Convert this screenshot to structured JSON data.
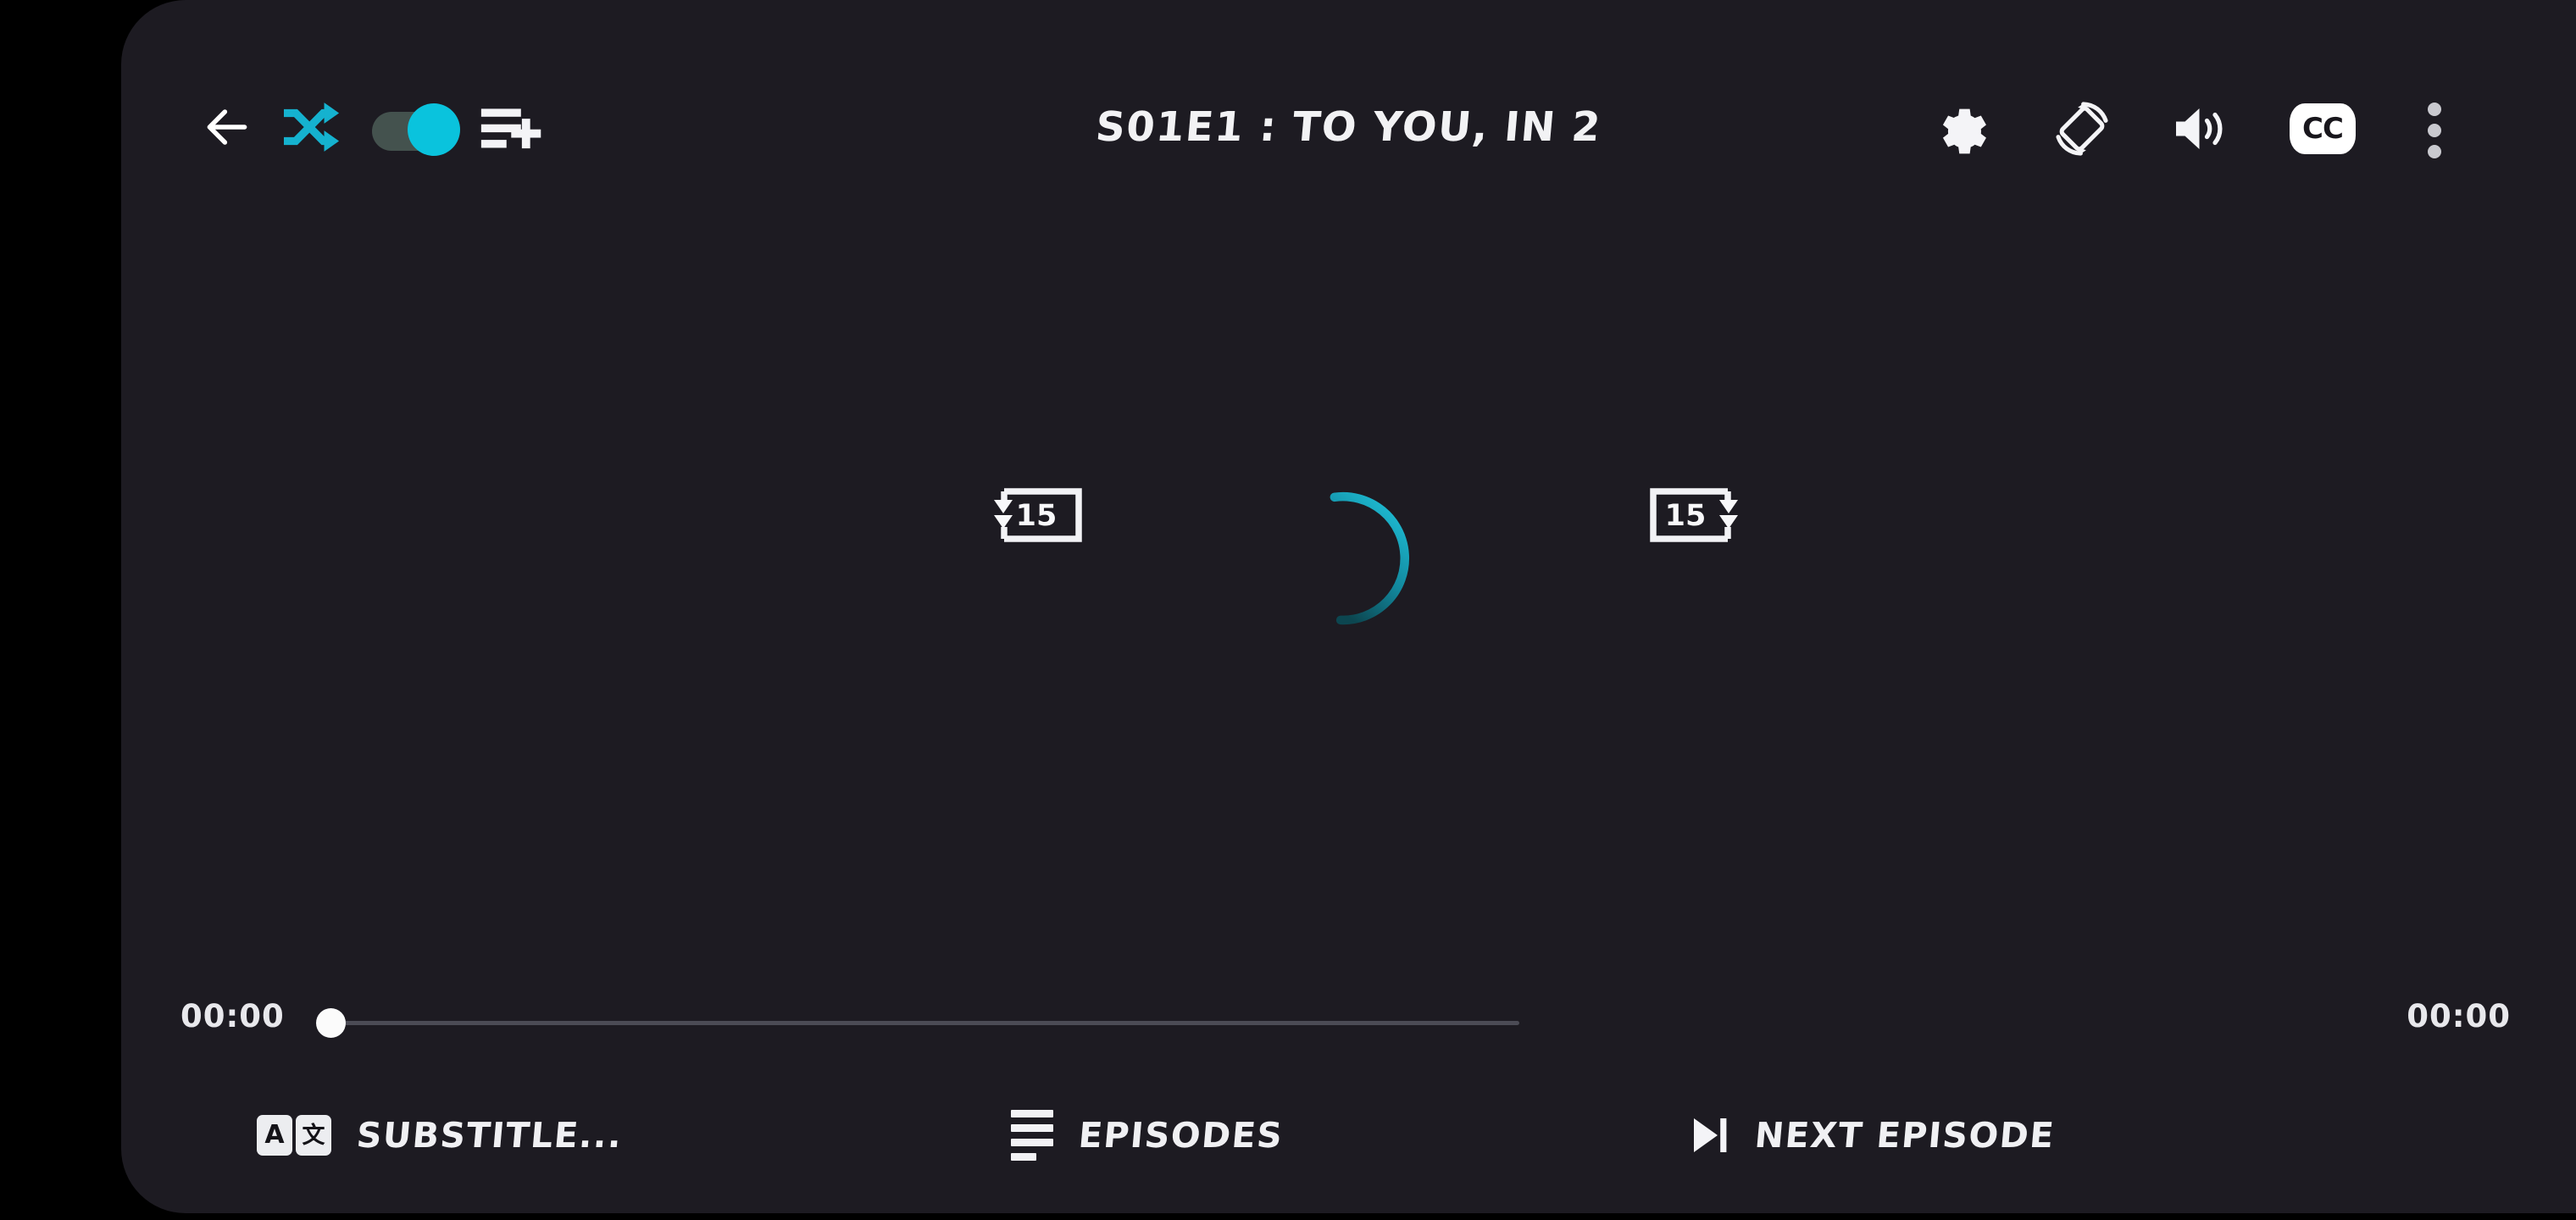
{
  "app": {
    "kind": "video-player-overlay",
    "accent_color": "#0ac3dd",
    "panel_bg": "#1d1b22",
    "outer_bg": "#000000"
  },
  "topbar": {
    "back_label": "back",
    "shuffle_label": "shuffle",
    "autoplay_toggle": {
      "state": "on",
      "label": "autoplay"
    },
    "playlist_add_label": "add to playlist",
    "title": "S01E1 : TO YOU, IN 2",
    "settings_label": "settings",
    "rotate_label": "screen rotation",
    "volume_label": "volume",
    "cc_label": "CC",
    "more_label": "more options"
  },
  "center": {
    "rewind_seconds": "15",
    "forward_seconds": "15",
    "loading": "buffering"
  },
  "timeline": {
    "current_time": "00:00",
    "duration": "00:00",
    "progress_percent": 0,
    "track_color": "#4b4b55",
    "thumb_color": "#fbfbfb"
  },
  "bottom_buttons": [
    {
      "icon": "translate-icon",
      "label": "SUBSTITLE...",
      "cell_left": "A",
      "cell_right": "文"
    },
    {
      "icon": "episodes-list-icon",
      "label": "EPISODES"
    },
    {
      "icon": "skip-next-icon",
      "label": "NEXT EPISODE"
    }
  ]
}
